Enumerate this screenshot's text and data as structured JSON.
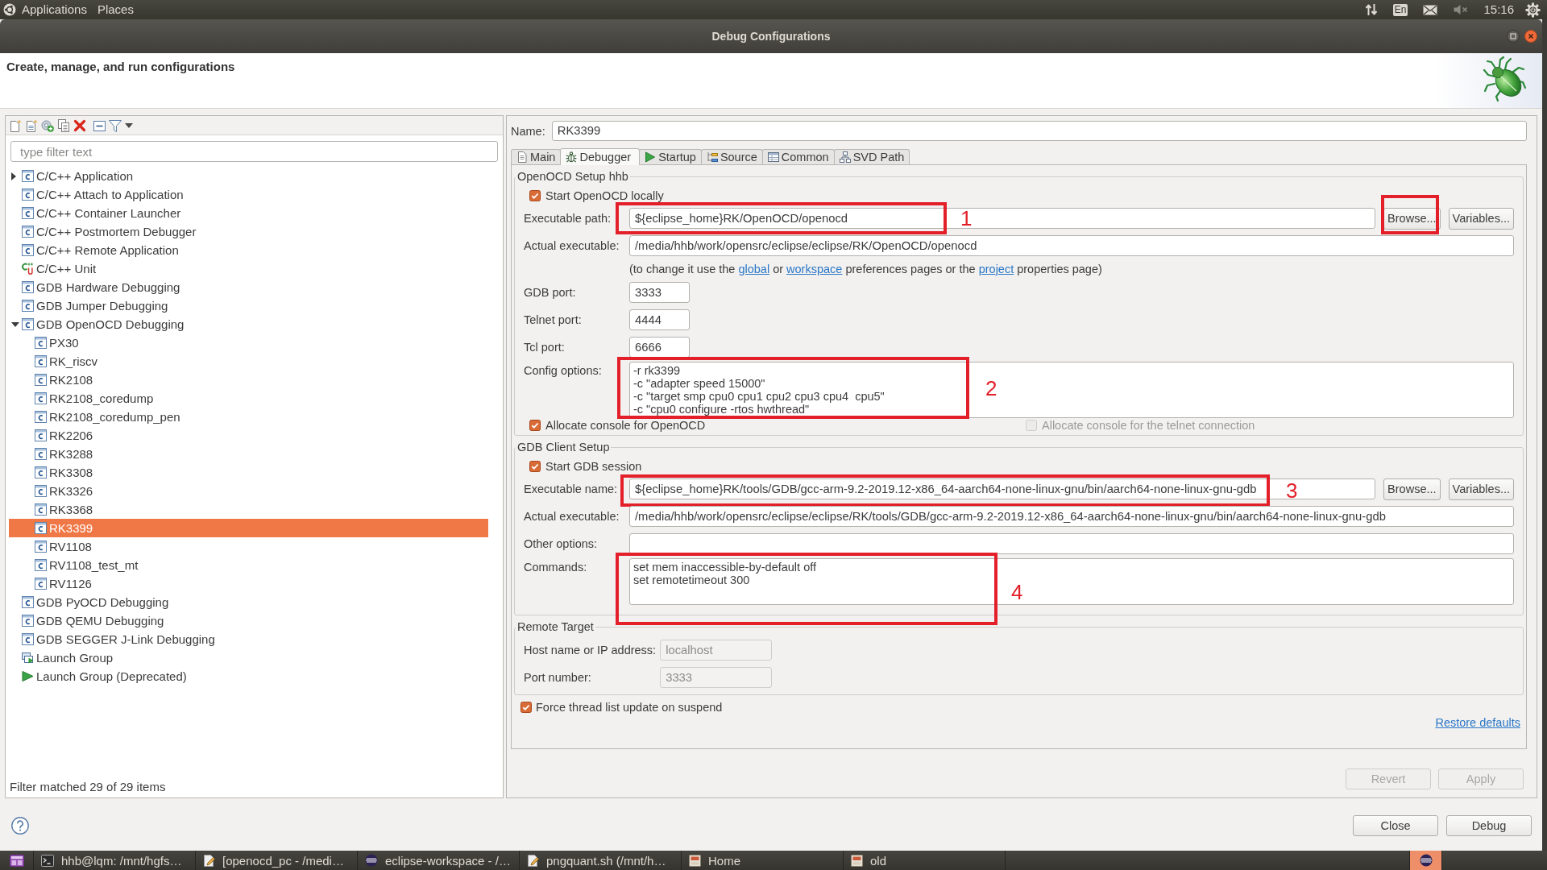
{
  "top_panel": {
    "menus": [
      "Applications",
      "Places"
    ],
    "keyboard_layout": "En",
    "clock": "15:16"
  },
  "window": {
    "title": "Debug Configurations"
  },
  "header": {
    "message": "Create, manage, and run configurations"
  },
  "config_list": {
    "filter": {
      "placeholder": "type filter text"
    },
    "items": [
      {
        "label": "C/C++ Application",
        "kind": "c",
        "expanded": false,
        "selected": false
      },
      {
        "label": "C/C++ Attach to Application",
        "kind": "c",
        "selected": false
      },
      {
        "label": "C/C++ Container Launcher",
        "kind": "c",
        "selected": false
      },
      {
        "label": "C/C++ Postmortem Debugger",
        "kind": "c",
        "selected": false
      },
      {
        "label": "C/C++ Remote Application",
        "kind": "c",
        "selected": false
      },
      {
        "label": "C/C++ Unit",
        "kind": "unit",
        "selected": false
      },
      {
        "label": "GDB Hardware Debugging",
        "kind": "c",
        "selected": false
      },
      {
        "label": "GDB Jumper Debugging",
        "kind": "c",
        "selected": false
      },
      {
        "label": "GDB OpenOCD Debugging",
        "kind": "c",
        "expanded": true,
        "selected": false,
        "children": [
          {
            "label": "PX30",
            "kind": "c",
            "selected": false
          },
          {
            "label": "RK_riscv",
            "kind": "c",
            "selected": false
          },
          {
            "label": "RK2108",
            "kind": "c",
            "selected": false
          },
          {
            "label": "RK2108_coredump",
            "kind": "c",
            "selected": false
          },
          {
            "label": "RK2108_coredump_pen",
            "kind": "c",
            "selected": false
          },
          {
            "label": "RK2206",
            "kind": "c",
            "selected": false
          },
          {
            "label": "RK3288",
            "kind": "c",
            "selected": false
          },
          {
            "label": "RK3308",
            "kind": "c",
            "selected": false
          },
          {
            "label": "RK3326",
            "kind": "c",
            "selected": false
          },
          {
            "label": "RK3368",
            "kind": "c",
            "selected": false
          },
          {
            "label": "RK3399",
            "kind": "c",
            "selected": true
          },
          {
            "label": "RV1108",
            "kind": "c",
            "selected": false
          },
          {
            "label": "RV1108_test_mt",
            "kind": "c",
            "selected": false
          },
          {
            "label": "RV1126",
            "kind": "c",
            "selected": false
          }
        ]
      },
      {
        "label": "GDB PyOCD Debugging",
        "kind": "c",
        "selected": false
      },
      {
        "label": "GDB QEMU Debugging",
        "kind": "c",
        "selected": false
      },
      {
        "label": "GDB SEGGER J-Link Debugging",
        "kind": "c",
        "selected": false
      },
      {
        "label": "Launch Group",
        "kind": "group",
        "selected": false
      },
      {
        "label": "Launch Group (Deprecated)",
        "kind": "play",
        "selected": false
      }
    ],
    "status": "Filter matched 29 of 29 items"
  },
  "editor": {
    "name": {
      "label": "Name:",
      "value": "RK3399"
    },
    "tabs": [
      {
        "label": "Main",
        "kind": "document",
        "selected": false
      },
      {
        "label": "Debugger",
        "kind": "bug",
        "selected": true
      },
      {
        "label": "Startup",
        "kind": "play",
        "selected": false
      },
      {
        "label": "Source",
        "kind": "source",
        "selected": false
      },
      {
        "label": "Common",
        "kind": "common",
        "selected": false
      },
      {
        "label": "SVD Path",
        "kind": "svd",
        "selected": false
      }
    ],
    "groups": [
      {
        "title": "OpenOCD Setup hhb",
        "rows": [
          {
            "kind": "checkbox",
            "label": "Start OpenOCD locally",
            "checked": true,
            "disabled": false
          },
          {
            "kind": "path",
            "label": "Executable path:",
            "value": "${eclipse_home}RK/OpenOCD/openocd",
            "disabled": false,
            "annotation": "1",
            "buttons": [
              {
                "label": "Browse...",
                "disabled": false,
                "annotated": true
              },
              {
                "label": "Variables...",
                "disabled": false,
                "annotated": false
              }
            ]
          },
          {
            "kind": "text",
            "label": "Actual executable:",
            "value": "/media/hhb/work/opensrc/eclipse/eclipse/RK/OpenOCD/openocd",
            "disabled": false
          },
          {
            "kind": "hint",
            "parts": [
              {
                "kind": "text",
                "text": "(to change it use the "
              },
              {
                "kind": "link",
                "text": "global"
              },
              {
                "kind": "text",
                "text": " or "
              },
              {
                "kind": "link",
                "text": "workspace"
              },
              {
                "kind": "text",
                "text": " preferences pages or the "
              },
              {
                "kind": "link",
                "text": "project"
              },
              {
                "kind": "text",
                "text": " properties page)"
              }
            ]
          },
          {
            "kind": "port",
            "label": "GDB port:",
            "value": "3333",
            "disabled": false
          },
          {
            "kind": "port",
            "label": "Telnet port:",
            "value": "4444",
            "disabled": false
          },
          {
            "kind": "port",
            "label": "Tcl port:",
            "value": "6666",
            "disabled": false
          },
          {
            "kind": "multiline",
            "label": "Config options:",
            "lines": [
              "-r rk3399",
              "-c \"adapter speed 15000\"",
              "-c \"target smp cpu0 cpu1 cpu2 cpu3 cpu4  cpu5\"",
              "-c \"cpu0 configure -rtos hwthread\""
            ],
            "annotation": "2"
          },
          {
            "kind": "checkboxes",
            "items": [
              {
                "label": "Allocate console for OpenOCD",
                "checked": true,
                "disabled": false
              },
              {
                "label": "Allocate console for the telnet connection",
                "checked": false,
                "disabled": true
              }
            ]
          }
        ]
      },
      {
        "title": "GDB Client Setup",
        "rows": [
          {
            "kind": "checkbox",
            "label": "Start GDB session",
            "checked": true,
            "disabled": false
          },
          {
            "kind": "path",
            "label": "Executable name:",
            "value": "${eclipse_home}RK/tools/GDB/gcc-arm-9.2-2019.12-x86_64-aarch64-none-linux-gnu/bin/aarch64-none-linux-gnu-gdb",
            "disabled": false,
            "annotation": "3",
            "buttons": [
              {
                "label": "Browse...",
                "disabled": false,
                "annotated": false
              },
              {
                "label": "Variables...",
                "disabled": false,
                "annotated": false
              }
            ]
          },
          {
            "kind": "text",
            "label": "Actual executable:",
            "value": "/media/hhb/work/opensrc/eclipse/eclipse/RK/tools/GDB/gcc-arm-9.2-2019.12-x86_64-aarch64-none-linux-gnu/bin/aarch64-none-linux-gnu-gdb",
            "disabled": false
          },
          {
            "kind": "text",
            "label": "Other options:",
            "disabled": false
          },
          {
            "kind": "multiline",
            "label": "Commands:",
            "lines": [
              "set mem inaccessible-by-default off",
              "set remotetimeout 300"
            ],
            "annotation": "4"
          }
        ]
      },
      {
        "title": "Remote Target",
        "rows": [
          {
            "kind": "address",
            "label": "Host name or IP address:",
            "value": "localhost",
            "disabled": true
          },
          {
            "kind": "address",
            "label": "Port number:",
            "value": "3333",
            "disabled": true
          }
        ]
      }
    ],
    "extra_rows": [
      {
        "kind": "checkbox",
        "label": "Force thread list update on suspend",
        "checked": true,
        "disabled": false
      }
    ],
    "restore_link": "Restore defaults",
    "buttons": [
      {
        "label": "Revert",
        "disabled": true
      },
      {
        "label": "Apply",
        "disabled": true
      }
    ]
  },
  "dialog_buttons": [
    {
      "label": "Close"
    },
    {
      "label": "Debug"
    }
  ],
  "taskbar": {
    "windows": [
      {
        "kind": "workspaces",
        "selected": false
      },
      {
        "kind": "terminal",
        "label": "hhb@lqm: /mnt/hgfs…",
        "selected": false
      },
      {
        "kind": "editor",
        "label": "[openocd_pc - /medi…",
        "selected": false
      },
      {
        "kind": "eclipse",
        "label": "eclipse-workspace - /…",
        "selected": false
      },
      {
        "kind": "editor",
        "label": "pngquant.sh (/mnt/h…",
        "selected": false
      },
      {
        "kind": "drawer",
        "label": "Home",
        "selected": false
      },
      {
        "kind": "drawer",
        "label": "old",
        "selected": false
      }
    ],
    "indicators": [
      {
        "kind": "eclipse",
        "selected": true
      }
    ]
  }
}
